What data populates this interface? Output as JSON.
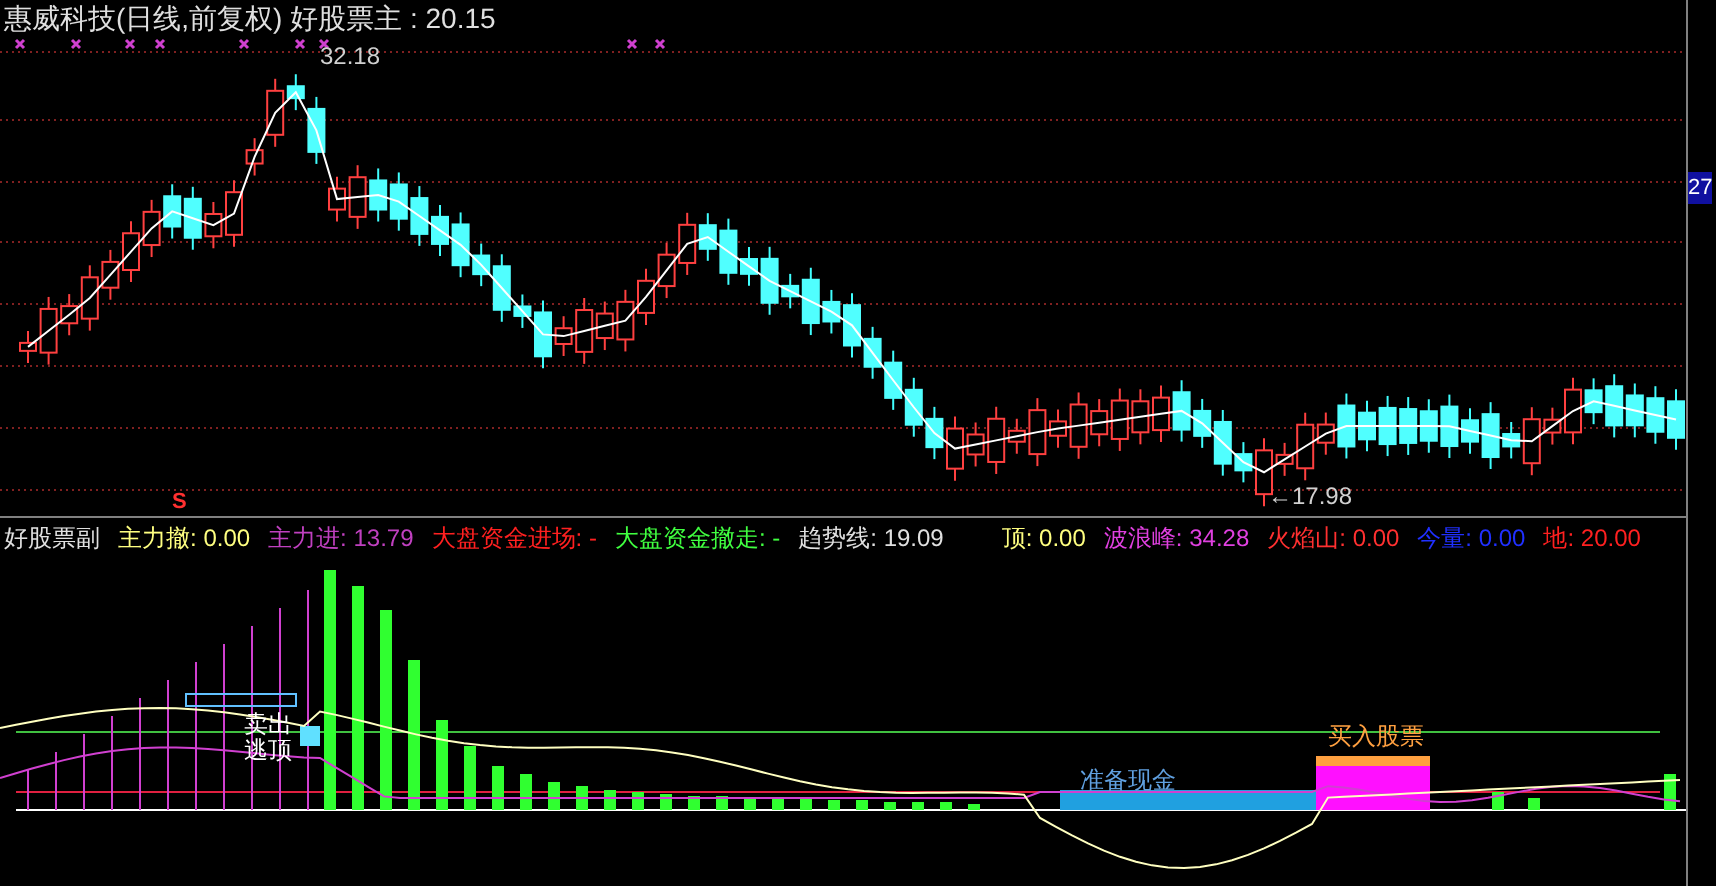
{
  "main_chart": {
    "title": "惠威科技(日线,前复权) 好股票主 : 20.15",
    "high_label": "32.18",
    "low_label": "←17.98",
    "axis_price": "27",
    "signal_mark": "S"
  },
  "sub_chart": {
    "title": "好股票副",
    "legend": [
      {
        "label": "主力撤:",
        "value": "0.00",
        "color": "#ffff80"
      },
      {
        "label": "主力进:",
        "value": "13.79",
        "color": "#c040c0"
      },
      {
        "label": "大盘资金进场:",
        "value": "-",
        "color": "#ff2020"
      },
      {
        "label": "大盘资金撤走:",
        "value": "-",
        "color": "#40ff40"
      },
      {
        "label": "趋势线:",
        "value": "19.09",
        "color": "#e0e0e0"
      },
      {
        "label": "顶:",
        "value": "0.00",
        "color": "#ffff80"
      },
      {
        "label": "波浪峰:",
        "value": "34.28",
        "color": "#e040e0"
      },
      {
        "label": "火焰山:",
        "value": "0.00",
        "color": "#ff3030"
      },
      {
        "label": "今量:",
        "value": "0.00",
        "color": "#2030ff"
      },
      {
        "label": "地:",
        "value": "20.00",
        "color": "#ff2020"
      }
    ],
    "labels": [
      {
        "kind": "sell",
        "text": "卖出逃顶"
      },
      {
        "kind": "cash",
        "text": "准备现金"
      },
      {
        "kind": "buy",
        "text": "买入股票"
      }
    ]
  }
}
